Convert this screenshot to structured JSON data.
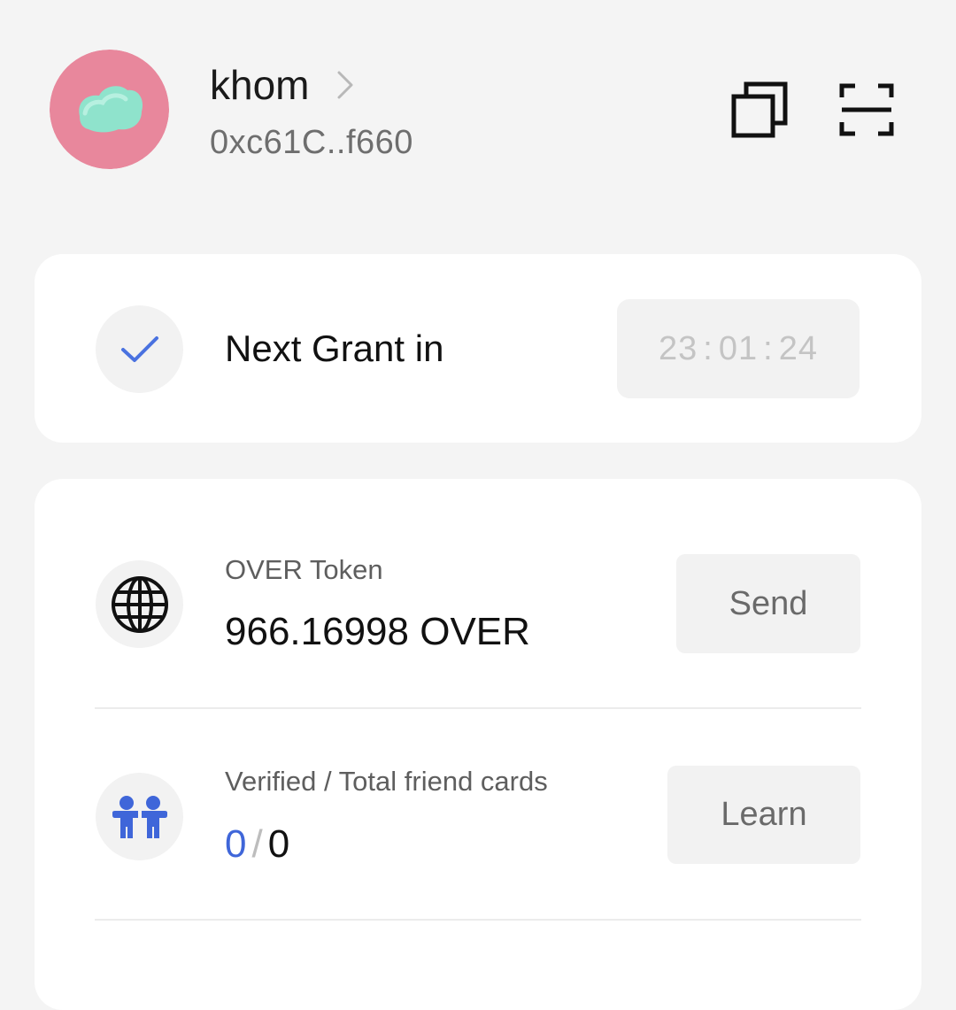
{
  "profile": {
    "name": "khom",
    "address": "0xc61C..f660",
    "avatar_bg_color": "#e8879c",
    "avatar_blob_color": "#8fe3cc"
  },
  "header_icons": {
    "copy": "copy-icon",
    "scan": "scan-icon"
  },
  "grant": {
    "icon": "check-icon",
    "label": "Next Grant in",
    "countdown": {
      "hours": "23",
      "minutes": "01",
      "seconds": "24",
      "separator": ":"
    }
  },
  "token": {
    "icon": "globe-icon",
    "title": "OVER Token",
    "balance": "966.16998 OVER",
    "action_label": "Send"
  },
  "friends": {
    "icon": "friends-icon",
    "title": "Verified / Total friend cards",
    "verified_count": "0",
    "separator": "/",
    "total_count": "0",
    "action_label": "Learn"
  },
  "colors": {
    "accent_blue": "#3f66d9",
    "background": "#f4f4f4",
    "card": "#ffffff"
  }
}
